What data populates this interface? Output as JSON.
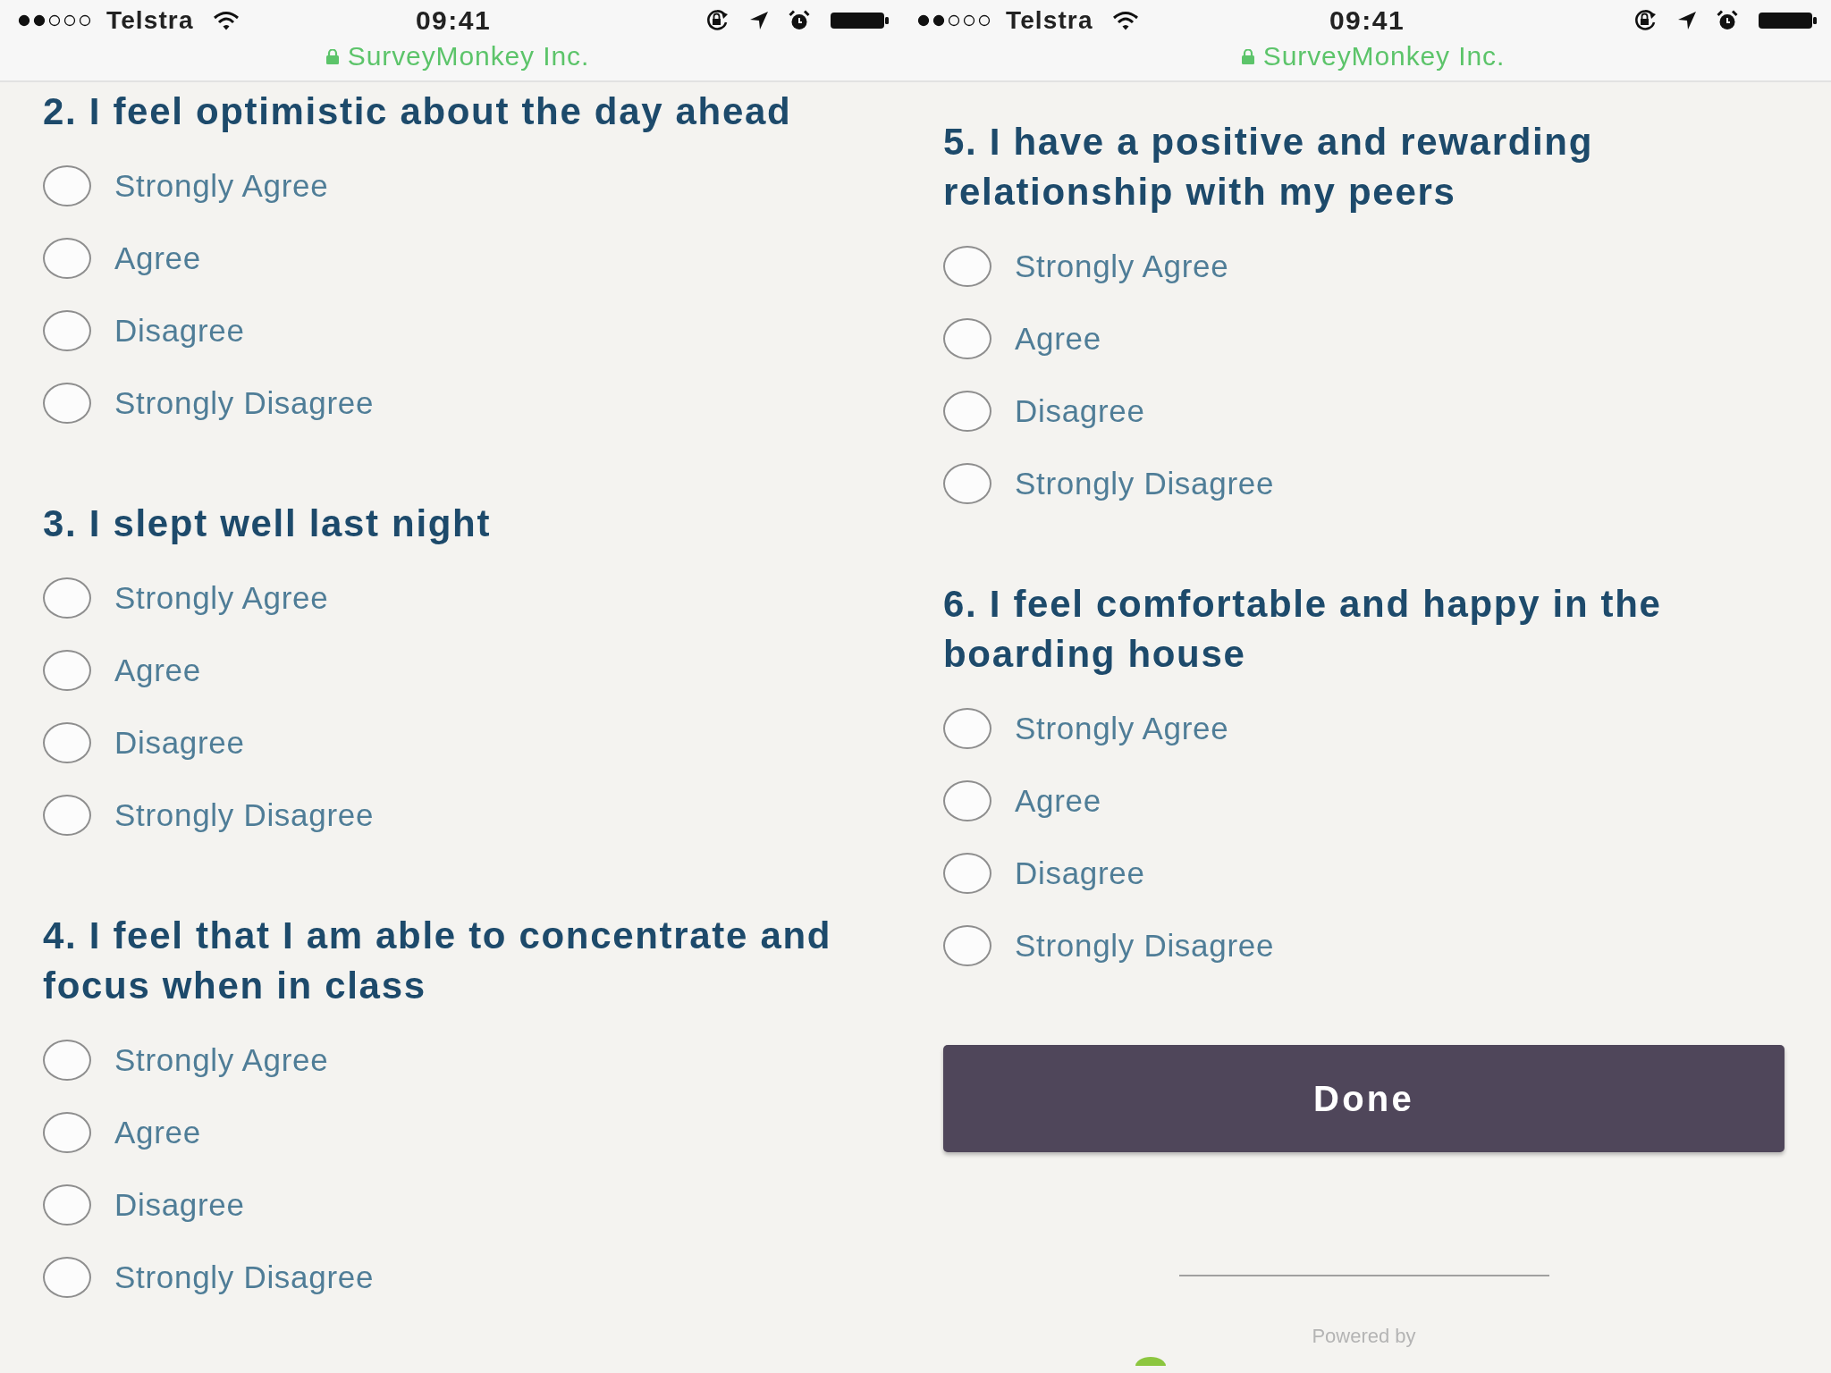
{
  "screens": [
    {
      "status_bar": {
        "carrier": "Telstra",
        "time": "09:41",
        "site": "SurveyMonkey Inc."
      },
      "questions": [
        {
          "title": "2. I feel optimistic about the day ahead",
          "options": [
            {
              "label": "Strongly Agree",
              "selected": false
            },
            {
              "label": "Agree",
              "selected": false
            },
            {
              "label": "Disagree",
              "selected": false
            },
            {
              "label": "Strongly Disagree",
              "selected": false
            }
          ]
        },
        {
          "title": "3. I slept well last night",
          "options": [
            {
              "label": "Strongly Agree",
              "selected": false
            },
            {
              "label": "Agree",
              "selected": false
            },
            {
              "label": "Disagree",
              "selected": false
            },
            {
              "label": "Strongly Disagree",
              "selected": false
            }
          ]
        },
        {
          "title": "4. I feel that I am able to concentrate and focus when in class",
          "options": [
            {
              "label": "Strongly Agree",
              "selected": false
            },
            {
              "label": "Agree",
              "selected": false
            },
            {
              "label": "Disagree",
              "selected": false
            },
            {
              "label": "Strongly Disagree",
              "selected": false
            }
          ]
        }
      ]
    },
    {
      "status_bar": {
        "carrier": "Telstra",
        "time": "09:41",
        "site": "SurveyMonkey Inc."
      },
      "questions": [
        {
          "title": "5. I have a positive and rewarding relationship with my peers",
          "options": [
            {
              "label": "Strongly Agree",
              "selected": false
            },
            {
              "label": "Agree",
              "selected": false
            },
            {
              "label": "Disagree",
              "selected": false
            },
            {
              "label": "Strongly Disagree",
              "selected": false
            }
          ]
        },
        {
          "title": "6. I feel comfortable and happy in the boarding house",
          "options": [
            {
              "label": "Strongly Agree",
              "selected": false
            },
            {
              "label": "Agree",
              "selected": false
            },
            {
              "label": "Disagree",
              "selected": false
            },
            {
              "label": "Strongly Disagree",
              "selected": false
            }
          ]
        }
      ],
      "done_button": "Done",
      "footer": {
        "powered_by": "Powered by"
      }
    }
  ]
}
